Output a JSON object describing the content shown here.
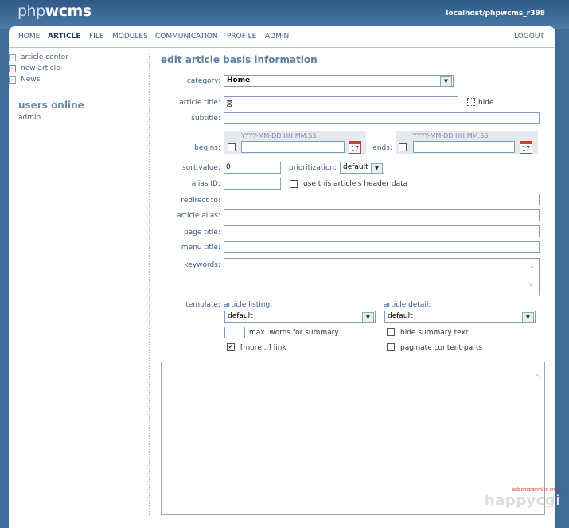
{
  "header": {
    "logo_php": "php",
    "logo_wcms": "wcms",
    "hostname": "localhost/phpwcms_r398"
  },
  "nav": {
    "items": [
      "HOME",
      "ARTICLE",
      "FILE",
      "MODULES",
      "COMMUNICATION",
      "PROFILE",
      "ADMIN"
    ],
    "active": "ARTICLE",
    "logout": "LOGOUT"
  },
  "sidebar": {
    "links": [
      "article center",
      "new article",
      "News"
    ],
    "users_online_title": "users online",
    "users": [
      "admin"
    ]
  },
  "form": {
    "title": "edit article basis information",
    "category_label": "category:",
    "category_value": "Home",
    "article_title_label": "article title:",
    "article_title_value": "홈",
    "hide_label": "hide",
    "subtitle_label": "subtitle:",
    "subtitle_value": "",
    "date_format": "YYYY-MM-DD HH:MM:SS",
    "begins_label": "begins:",
    "ends_label": "ends:",
    "calendar_day": "17",
    "sort_value_label": "sort value:",
    "sort_value": "0",
    "prioritization_label": "prioritization:",
    "prioritization_value": "default",
    "alias_id_label": "alias ID:",
    "alias_id_value": "",
    "use_header_data_label": "use this article's header data",
    "redirect_label": "redirect to:",
    "article_alias_label": "article alias:",
    "page_title_label": "page title:",
    "menu_title_label": "menu title:",
    "keywords_label": "keywords:",
    "template_label": "template:",
    "article_listing_label": "article listing:",
    "article_listing_value": "default",
    "article_detail_label": "article detail:",
    "article_detail_value": "default",
    "max_words_label": "max. words for summary",
    "hide_summary_label": "hide summary text",
    "more_link_label": "[more...] link",
    "paginate_label": "paginate content parts"
  },
  "watermark": {
    "small": "web programming group",
    "big": "happycgi"
  }
}
